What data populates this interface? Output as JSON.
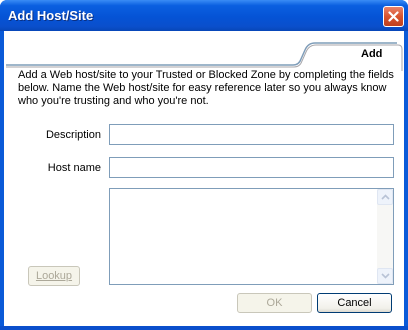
{
  "window": {
    "title": "Add Host/Site"
  },
  "icons": {
    "close": "close-icon",
    "scroll_up": "chevron-up-icon",
    "scroll_down": "chevron-down-icon"
  },
  "tab": {
    "label": "Add"
  },
  "instructions": "Add a Web host/site to your Trusted or Blocked Zone by completing the fields below.  Name the Web host/site for easy reference later so you always know who you're trusting and who you're not.",
  "form": {
    "description_label": "Description",
    "description_value": "",
    "hostname_label": "Host name",
    "hostname_value": ""
  },
  "buttons": {
    "lookup": "Lookup",
    "ok": "OK",
    "cancel": "Cancel"
  },
  "colors": {
    "titlebar": "#0553d6",
    "close_button": "#d8532e",
    "input_border": "#7f9db9",
    "disabled_text": "#aca899"
  }
}
